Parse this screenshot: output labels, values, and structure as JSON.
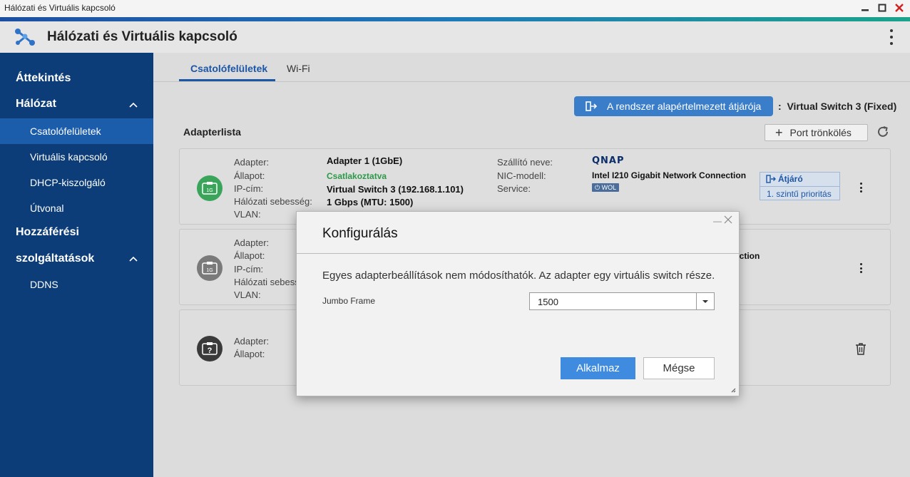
{
  "window": {
    "title": "Hálózati és Virtuális kapcsoló"
  },
  "app": {
    "title": "Hálózati és Virtuális kapcsoló"
  },
  "sidebar": {
    "overview": "Áttekintés",
    "network": "Hálózat",
    "items": [
      "Csatolófelületek",
      "Virtuális kapcsoló",
      "DHCP-kiszolgáló",
      "Útvonal"
    ],
    "access_line1": "Hozzáférési",
    "access_line2": "szolgáltatások",
    "access_items": [
      "DDNS"
    ]
  },
  "tabs": [
    "Csatolófelületek",
    "Wi-Fi"
  ],
  "gateway": {
    "button": "A rendszer alapértelmezett átjárója",
    "colon": ":",
    "value": "Virtual Switch 3 (Fixed)"
  },
  "adapterlist": {
    "title": "Adapterlista",
    "trunk_button": "Port trönkölés",
    "labels": {
      "adapter": "Adapter:",
      "status": "Állapot:",
      "ip": "IP-cím:",
      "speed": "Hálózati sebesség:",
      "speed_cut": "Hálózati sebess",
      "vlan": "VLAN:",
      "vendor": "Szállító neve:",
      "nic": "NIC-modell:",
      "service": "Service:"
    },
    "cards": [
      {
        "icon": "1G",
        "adapter": "Adapter 1 (1GbE)",
        "status": "Csatlakoztatva",
        "ip_link": "Virtual Switch 3",
        "ip_rest": " (192.168.1.101)",
        "speed": "1 Gbps (MTU: 1500)",
        "vendor_logo": "QNAP",
        "nic_model": "Intel I210 Gigabit Network Connection",
        "service_badge": "WOL",
        "gateway_tag": "Átjáró",
        "priority": "1. szintű prioritás"
      },
      {
        "icon": "1G",
        "nic_partial": "ection"
      },
      {
        "icon": "?"
      }
    ]
  },
  "modal": {
    "title": "Konfigurálás",
    "message": "Egyes adapterbeállítások nem módosíthatók. Az adapter egy virtuális switch része.",
    "jumbo_label": "Jumbo Frame",
    "jumbo_value": "1500",
    "apply": "Alkalmaz",
    "cancel": "Mégse",
    "minimize": "—"
  },
  "colors": {
    "sidebar": "#0c3d78",
    "sidebar_active": "#1b5cab",
    "accent": "#3a7dc8",
    "connected": "#2a9a47"
  }
}
